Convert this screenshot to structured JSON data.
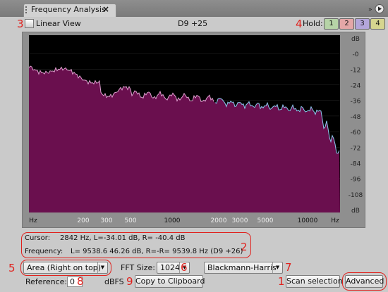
{
  "tab": {
    "title": "Frequency Analysis",
    "close": "×"
  },
  "toolbar": {
    "linear_view_label": "Linear View",
    "note": "D9 +25",
    "hold_label": "Hold:",
    "hold_buttons": [
      {
        "label": "1",
        "color": "#b6d3a7"
      },
      {
        "label": "2",
        "color": "#e4a7a7"
      },
      {
        "label": "3",
        "color": "#b3a6da"
      },
      {
        "label": "4",
        "color": "#d6d58f"
      }
    ]
  },
  "graph": {
    "background": "#000000",
    "fill_color": "#6a0f4e",
    "edge_color_left": "#e0a0d0",
    "edge_color_right": "#8ec9f0",
    "db_labels": [
      "dB",
      "-0",
      "-12",
      "-24",
      "-36",
      "-48",
      "-60",
      "-72",
      "-84",
      "-96",
      "-108",
      "dB"
    ],
    "freq_labels": [
      {
        "text": "Hz",
        "major": true
      },
      {
        "text": "200",
        "major": false
      },
      {
        "text": "300",
        "major": false
      },
      {
        "text": "500",
        "major": false
      },
      {
        "text": "1000",
        "major": true
      },
      {
        "text": "2000",
        "major": false
      },
      {
        "text": "3000",
        "major": false
      },
      {
        "text": "5000",
        "major": false
      },
      {
        "text": "10000",
        "major": true
      },
      {
        "text": "Hz",
        "major": true
      }
    ]
  },
  "readout": {
    "cursor_label": "Cursor:",
    "cursor_value": "2842 Hz, L=-34.01 dB, R= -40.4 dB",
    "frequency_label": "Frequency:",
    "frequency_value": "L= 9538.6 46.26 dB, R=-R= 9539.8 Hz (D9 +26)"
  },
  "controls": {
    "graph_mode": "Area (Right on top)",
    "fft_label": "FFT Size:",
    "fft_value": "1024",
    "window_value": "Blackmann-Harris",
    "reference_label": "Reference:",
    "reference_value": "0",
    "dbfs_label": "dBFS",
    "copy_button": "Copy to Clipboard",
    "scan_button": "Scan selection",
    "advanced_button": "Advanced"
  },
  "annotations": {
    "n1": "1",
    "n2": "2",
    "n3": "3",
    "n4": "4",
    "n5": "5",
    "n6": "6",
    "n7": "7",
    "n8": "8",
    "n9": "9"
  }
}
